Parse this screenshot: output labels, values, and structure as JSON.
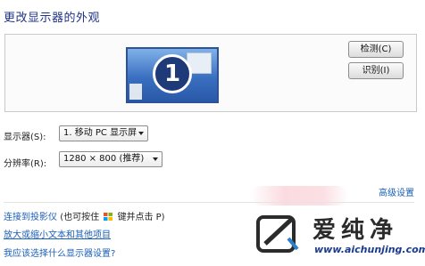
{
  "page_title": "更改显示器的外观",
  "preview": {
    "monitor_number": "1"
  },
  "buttons": {
    "detect": "检测(C)",
    "identify": "识别(I)"
  },
  "fields": {
    "display_label": "显示器(S):",
    "display_value": "1. 移动 PC 显示屏",
    "resolution_label": "分辨率(R):",
    "resolution_value": "1280 × 800 (推荐)"
  },
  "links": {
    "advanced": "高级设置",
    "projector": "连接到投影仪",
    "projector_hint_before": "(也可按住",
    "projector_hint_after": "键并点击 P)",
    "text_size": "放大或缩小文本和其他项目",
    "which_settings": "我应该选择什么显示器设置?"
  },
  "watermark": {
    "brand": "爱纯净",
    "url": "www.aichunjing.com"
  },
  "colors": {
    "title": "#1e3287",
    "link": "#1a5fb8",
    "monitor_border": "#2e5298"
  }
}
